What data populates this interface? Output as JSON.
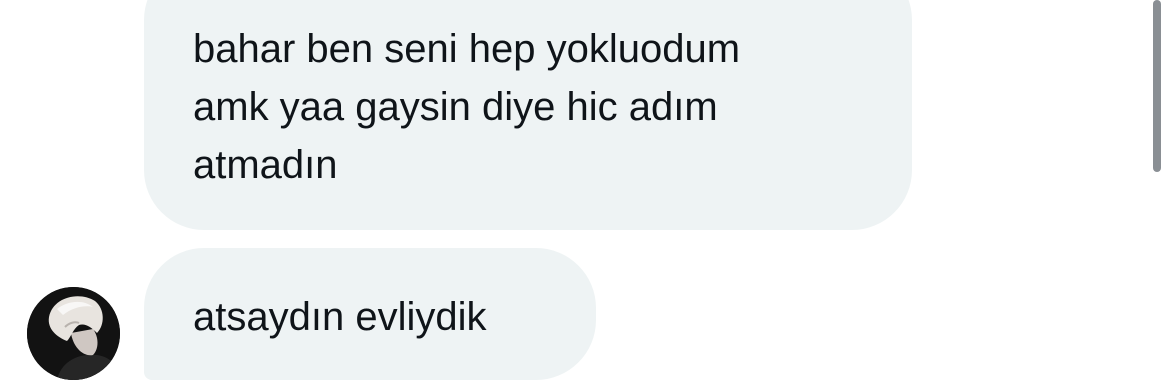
{
  "messages": [
    {
      "sender": "other",
      "lines": [
        "bahar ben seni hep yokluodum",
        "amk yaa gaysin diye hic adım",
        "atmadın"
      ]
    },
    {
      "sender": "other",
      "text": "atsaydın evliydik"
    }
  ],
  "colors": {
    "bubble": "#eef3f4",
    "text": "#0f1419",
    "background": "#ffffff",
    "scrollbar": "#8a8f94"
  }
}
